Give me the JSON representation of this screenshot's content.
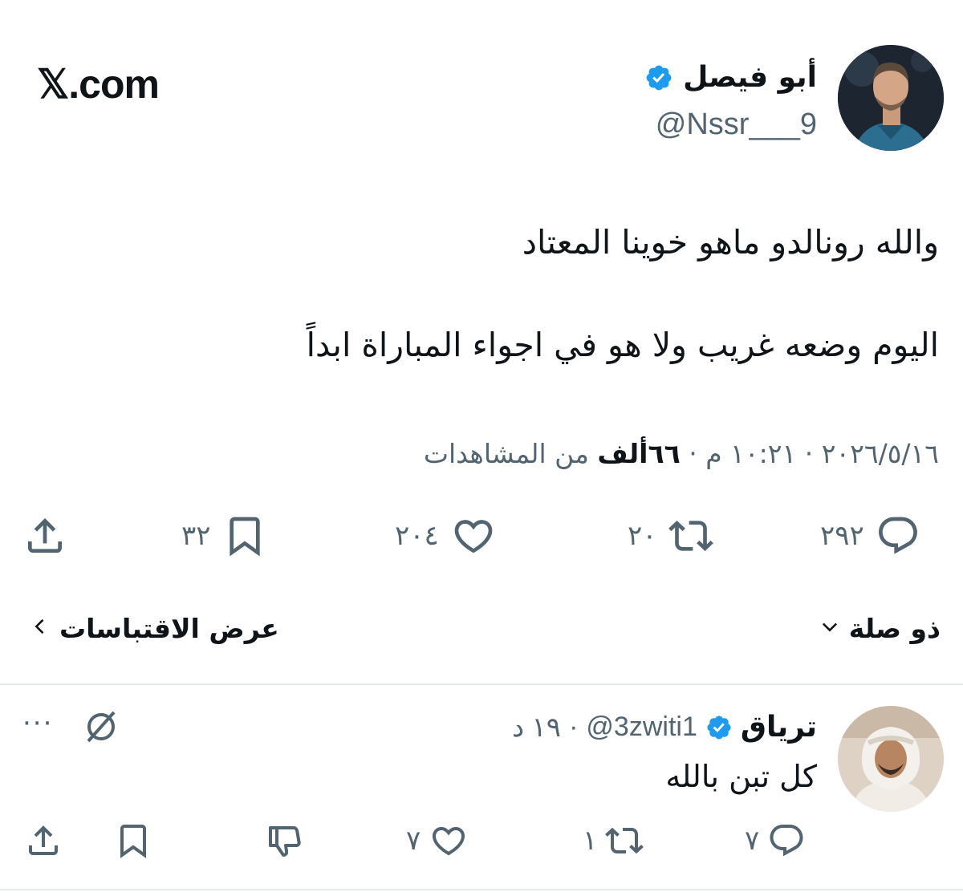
{
  "site": {
    "logo": "𝕏.com"
  },
  "tweet": {
    "author_name": "أبو فيصل",
    "author_handle": "@Nssr___9",
    "verified": true,
    "body_line1": "والله رونالدو ماهو خوينا المعتاد",
    "body_line2": "اليوم وضعه غريب ولا هو في اجواء المباراة ابداً",
    "date": "٢٠٢٦/٥/١٦",
    "time": "١٠:٢١ م",
    "separator": "·",
    "views_count": "٦٦ألف",
    "views_label": "من المشاهدات",
    "actions": {
      "replies": "٢٩٢",
      "retweets": "٢٠",
      "likes": "٢٠٤",
      "bookmarks": "٣٢"
    }
  },
  "filters": {
    "relevant_label": "ذو صلة",
    "quotes_label": "عرض الاقتباسات",
    "chevron_down": "⌵",
    "chevron_left": "<"
  },
  "reply": {
    "author_name": "ترياق",
    "author_handle": "@3zwiti1",
    "verified": true,
    "time": "١٩ د",
    "separator": "·",
    "text": "كل تبن بالله",
    "more": "···",
    "actions": {
      "replies": "٧",
      "retweets": "١",
      "likes": "٧"
    }
  },
  "colors": {
    "text": "#0f1419",
    "secondary": "#536471",
    "verified": "#1d9bf0",
    "divider": "#e6e9eb"
  },
  "icons": [
    "reply-icon",
    "retweet-icon",
    "like-icon",
    "bookmark-icon",
    "share-icon",
    "verified-badge-icon",
    "grok-icon",
    "dislike-icon",
    "more-icon"
  ]
}
